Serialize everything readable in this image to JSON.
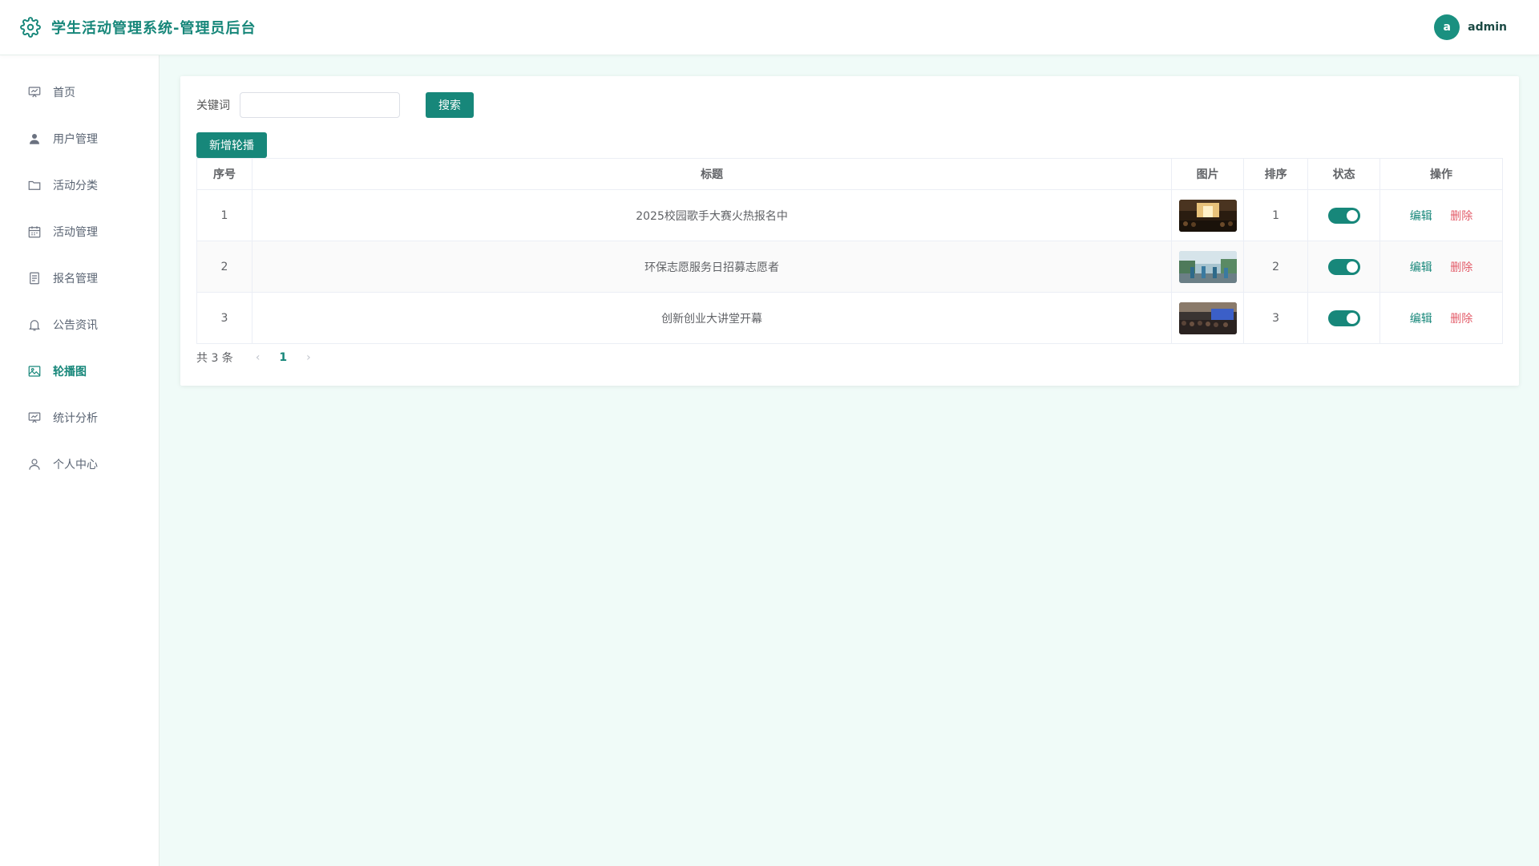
{
  "header": {
    "title": "学生活动管理系统-管理员后台",
    "avatar_letter": "a",
    "username": "admin"
  },
  "sidebar": {
    "items": [
      {
        "label": "首页",
        "icon": "presentation-icon"
      },
      {
        "label": "用户管理",
        "icon": "user-icon"
      },
      {
        "label": "活动分类",
        "icon": "folder-icon"
      },
      {
        "label": "活动管理",
        "icon": "calendar-icon"
      },
      {
        "label": "报名管理",
        "icon": "document-icon"
      },
      {
        "label": "公告资讯",
        "icon": "bell-icon"
      },
      {
        "label": "轮播图",
        "icon": "image-icon",
        "active": true
      },
      {
        "label": "统计分析",
        "icon": "chart-icon"
      },
      {
        "label": "个人中心",
        "icon": "user-outline-icon"
      }
    ]
  },
  "search": {
    "label": "关键词",
    "value": "",
    "placeholder": "",
    "button": "搜索"
  },
  "toolbar": {
    "add_label": "新增轮播"
  },
  "table": {
    "columns": [
      "序号",
      "标题",
      "图片",
      "排序",
      "状态",
      "操作"
    ],
    "rows": [
      {
        "index": "1",
        "title": "2025校园歌手大赛火热报名中",
        "sort": "1",
        "enabled": true,
        "edit": "编辑",
        "delete": "删除"
      },
      {
        "index": "2",
        "title": "环保志愿服务日招募志愿者",
        "sort": "2",
        "enabled": true,
        "edit": "编辑",
        "delete": "删除"
      },
      {
        "index": "3",
        "title": "创新创业大讲堂开幕",
        "sort": "3",
        "enabled": true,
        "edit": "编辑",
        "delete": "删除"
      }
    ]
  },
  "pagination": {
    "total_text": "共 3 条",
    "current_page": "1",
    "prev": "‹",
    "next": "›"
  },
  "colors": {
    "accent": "#17877a",
    "danger": "#e35d6a",
    "background": "#f0fbf8"
  }
}
